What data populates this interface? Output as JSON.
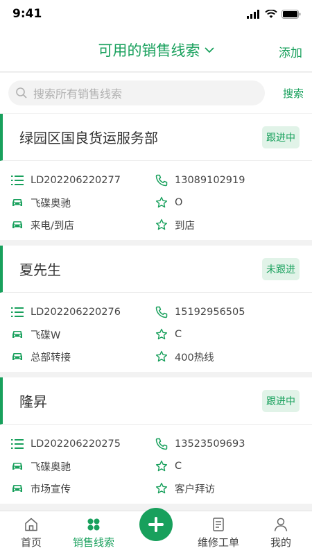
{
  "status": {
    "time": "9:41"
  },
  "header": {
    "title": "可用的销售线索",
    "add_label": "添加"
  },
  "search": {
    "placeholder": "搜索所有销售线索",
    "button_label": "搜索"
  },
  "leads": [
    {
      "name": "绿园区国良货运服务部",
      "status": "跟进中",
      "code": "LD202206220277",
      "phone": "13089102919",
      "car": "飞碟奥驰",
      "level": "O",
      "source": "来电/到店",
      "channel": "到店"
    },
    {
      "name": "夏先生",
      "status": "未跟进",
      "code": "LD202206220276",
      "phone": "15192956505",
      "car": "飞碟W",
      "level": "C",
      "source": "总部转接",
      "channel": "400热线"
    },
    {
      "name": "隆昇",
      "status": "跟进中",
      "code": "LD202206220275",
      "phone": "13523509693",
      "car": "飞碟奥驰",
      "level": "C",
      "source": "市场宣传",
      "channel": "客户拜访"
    }
  ],
  "tabbar": {
    "home": "首页",
    "leads": "销售线索",
    "repair": "维修工单",
    "mine": "我的"
  },
  "colors": {
    "accent": "#18a05c"
  }
}
